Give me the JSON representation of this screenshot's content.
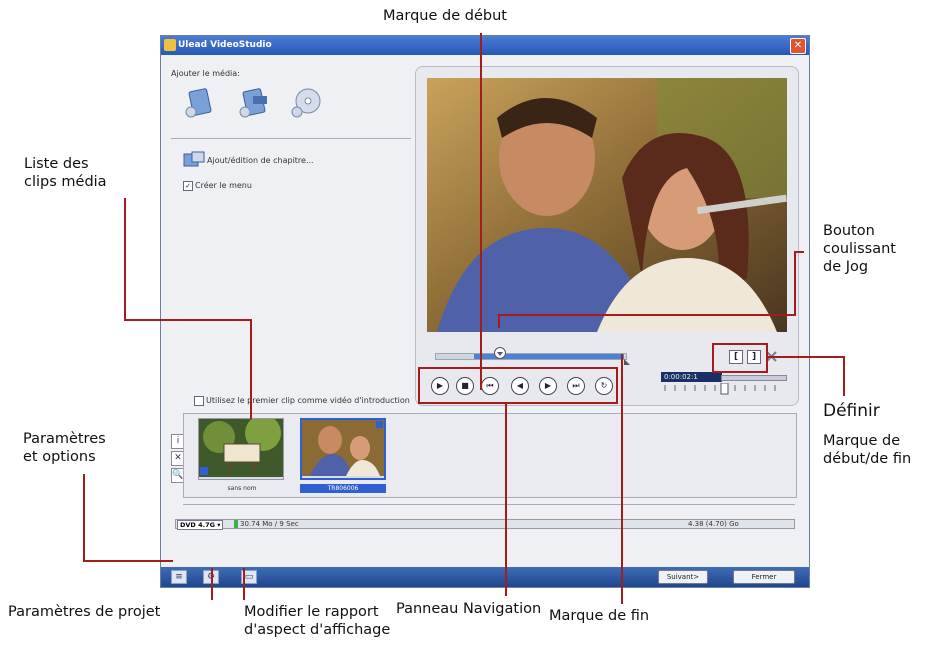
{
  "callouts": {
    "start_mark": "Marque de début",
    "clip_list": [
      "Liste des",
      "clips média"
    ],
    "jog_slider": [
      "Bouton",
      "coulissant",
      "de Jog"
    ],
    "define": "Définir",
    "define_sub": [
      "Marque de",
      "début/de fin"
    ],
    "settings": [
      "Paramètres",
      "et options"
    ],
    "nav_panel": "Panneau Navigation",
    "end_mark": "Marque de fin",
    "project_settings": "Paramètres de projet",
    "aspect_ratio": [
      "Modifier le rapport",
      "d'aspect d'affichage"
    ]
  },
  "window": {
    "title": "Ulead VideoStudio",
    "close_glyph": "✕",
    "add_media_label": "Ajouter le média:",
    "chapter_label": "Ajout/édition de chapitre...",
    "create_menu_label": "Créer le menu",
    "create_menu_checked": "✓",
    "use_first_clip_label": "Utilisez le premier clip comme vidéo d'introduction",
    "timecode": "0:00:02:1",
    "clips": [
      {
        "name": "sans nom"
      },
      {
        "name": "TR806006"
      }
    ],
    "disc_select": "DVD 4.7G ▾",
    "size_info": "30.74 Mo / 9 Sec",
    "disc_capacity": "4.38 (4.70) Go",
    "next_button": "Suivant>",
    "close_button": "Fermer"
  },
  "nav_buttons": [
    "▶",
    "■",
    "⏮",
    "◀",
    "▶",
    "⏭",
    "↻"
  ],
  "side_buttons": [
    "i",
    "✕",
    "🔍"
  ],
  "bracket_buttons": [
    "[",
    "]"
  ],
  "colors": {
    "callout_line": "#a51c1c",
    "title_bar": "#2657b6",
    "selection": "#2f5fd0"
  }
}
